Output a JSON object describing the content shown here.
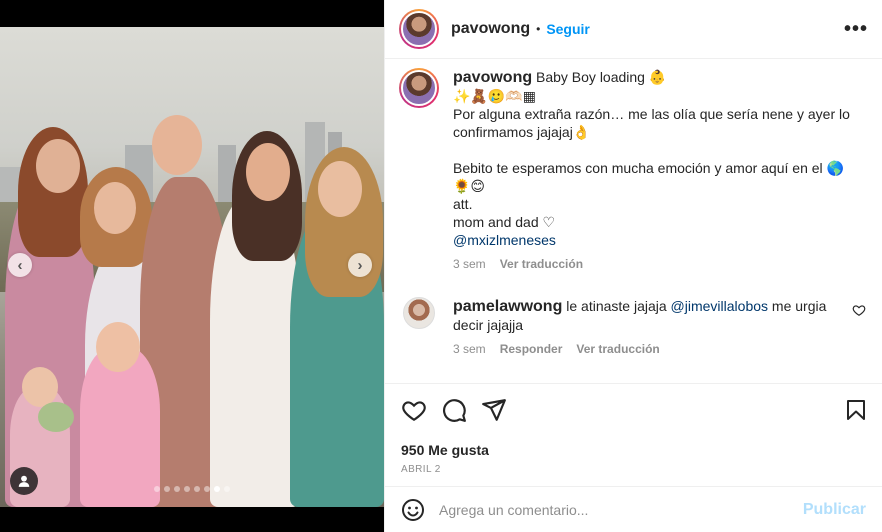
{
  "post": {
    "username": "pavowong",
    "separator": "•",
    "follow_label": "Seguir",
    "more_label": "•••"
  },
  "caption": {
    "username": "pavowong",
    "line1": "Baby Boy loading 👶",
    "line2": "✨🧸🥲🫶🏻▦",
    "line3": "Por alguna extraña razón… me las olía que sería nene y ayer lo confirmamos jajajaj👌",
    "line4": "Bebito te esperamos con mucha emoción y amor aquí en el 🌎",
    "line5": "🌻😊",
    "line6": "att.",
    "line7": "mom and dad ♡",
    "mention": "@mxizlmeneses",
    "time": "3 sem",
    "translate": "Ver traducción"
  },
  "reply": {
    "username": "pamelawwong",
    "text_before": " le atinaste jajaja ",
    "mention": "@jimevillalobos",
    "text_after": " me urgia decir jajajja",
    "time": "3 sem",
    "reply_label": "Responder",
    "translate": "Ver traducción"
  },
  "actions": {
    "likes": "950 Me gusta",
    "date": "ABRIL 2"
  },
  "comment_box": {
    "placeholder": "Agrega un comentario...",
    "post_label": "Publicar"
  },
  "carousel": {
    "prev": "‹",
    "next": "›",
    "slide_count": 8,
    "active_index": 6
  },
  "colors": {
    "accent": "#0095f6",
    "post_disabled": "#b2dffc",
    "mention": "#00376b",
    "muted": "#8e8e8e"
  }
}
